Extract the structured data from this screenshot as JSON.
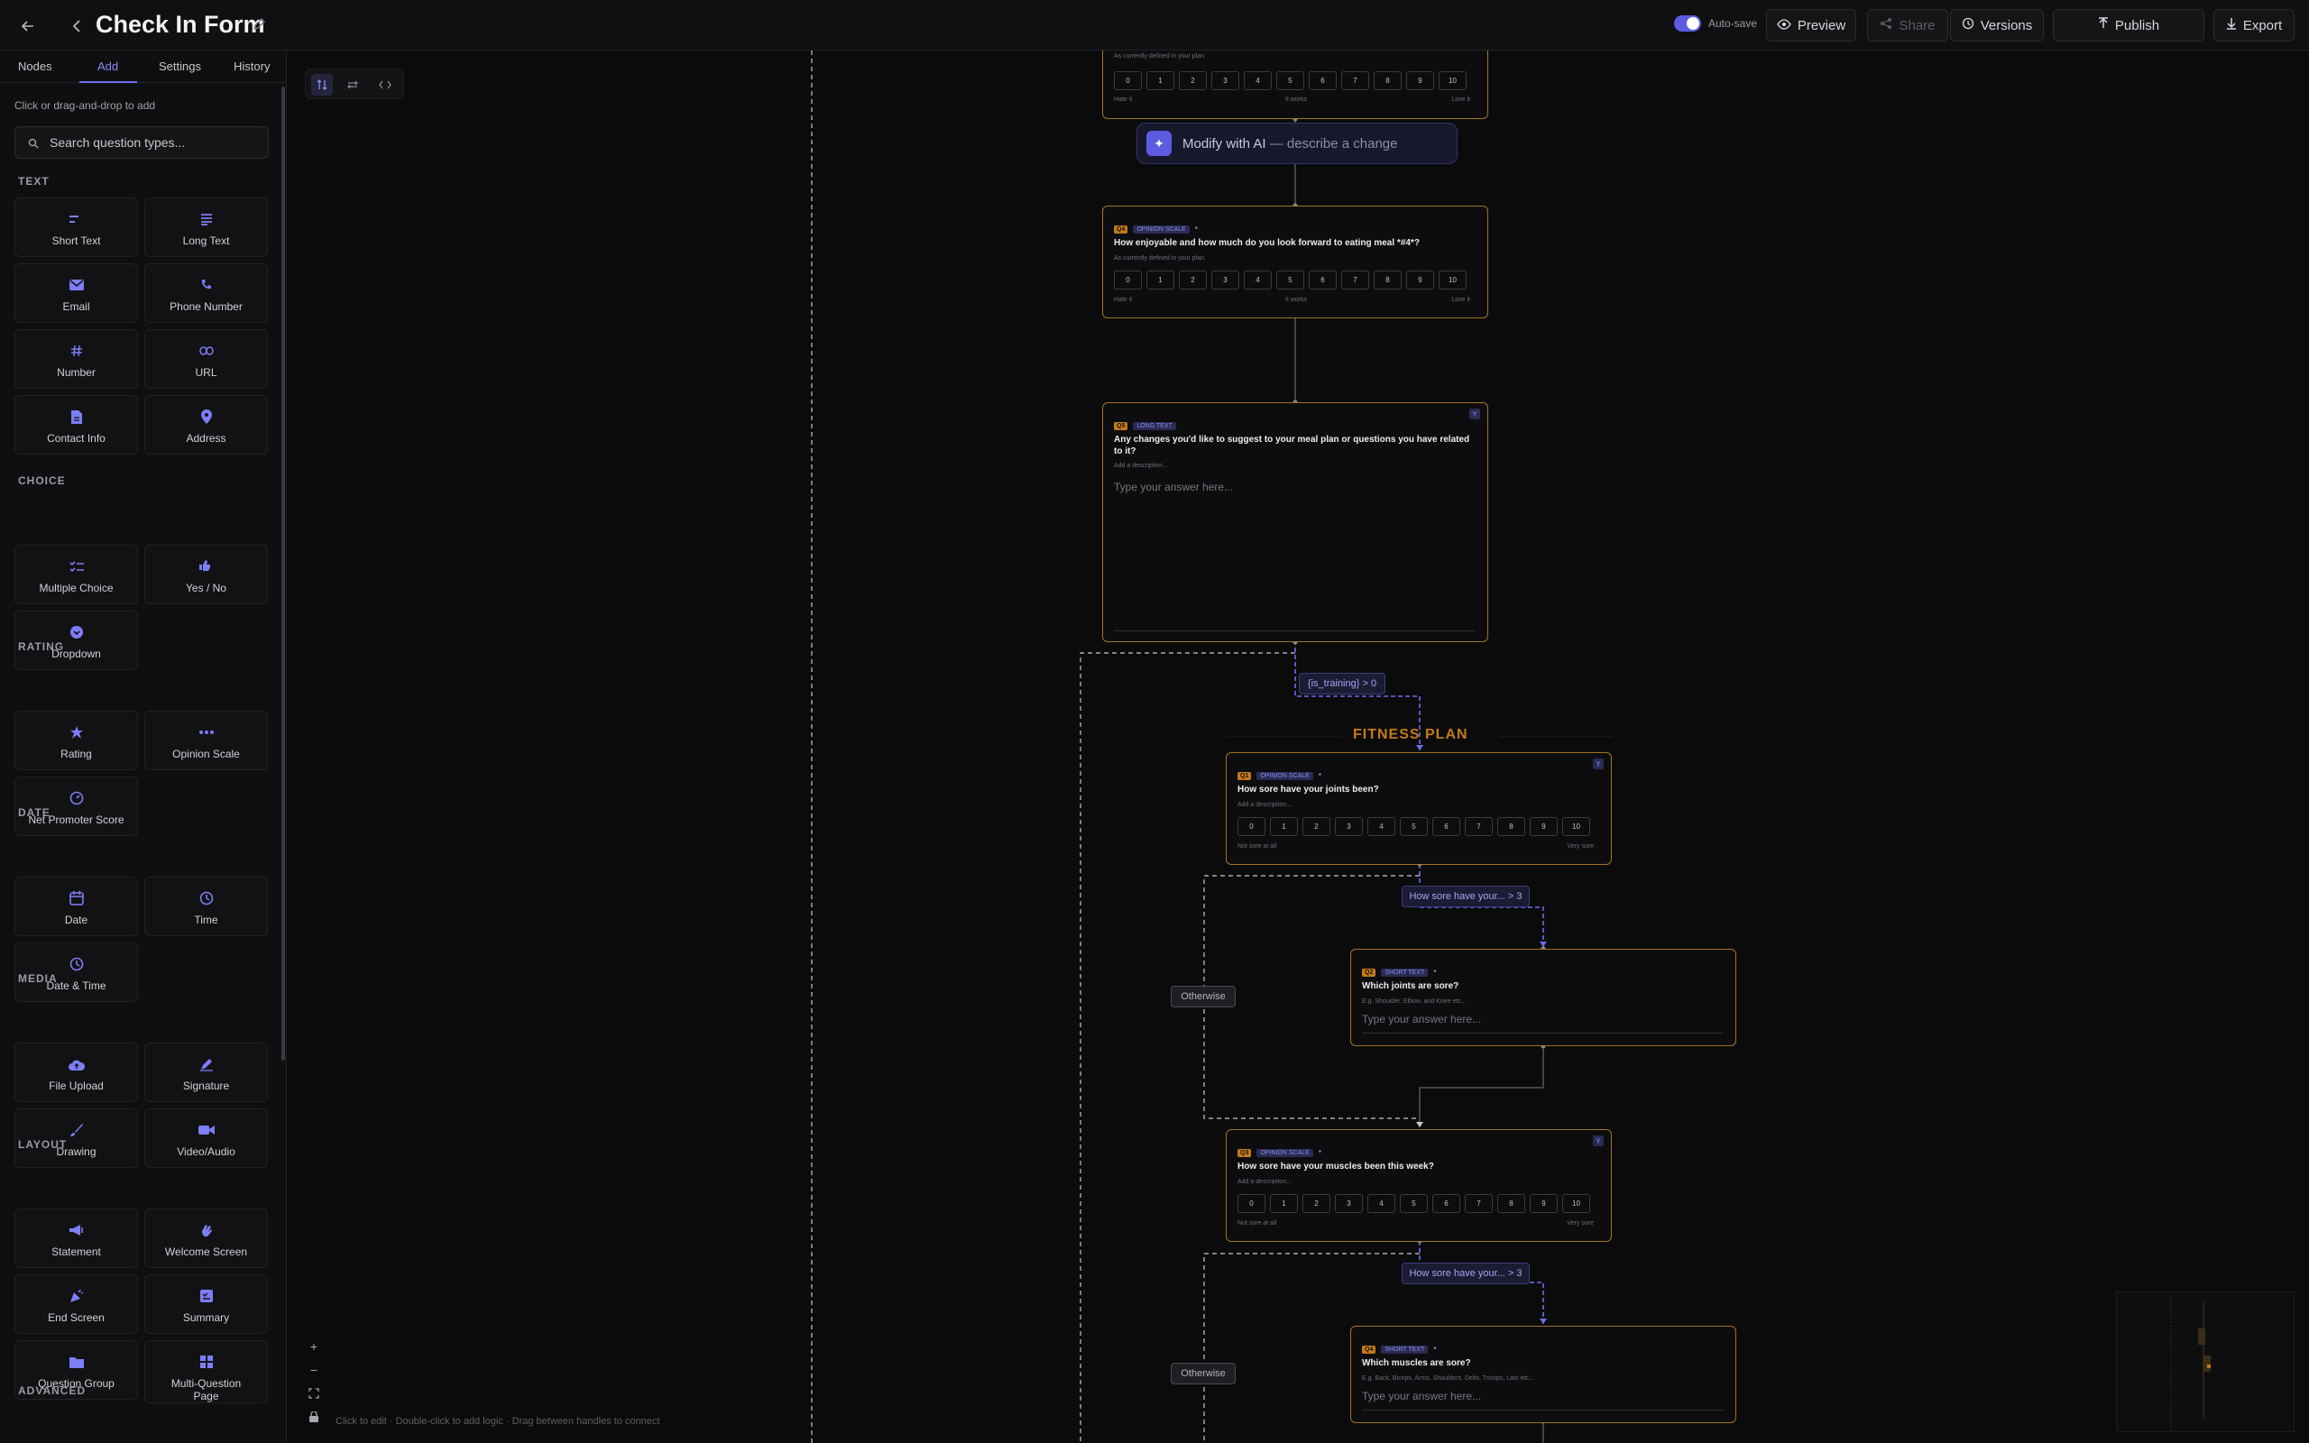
{
  "header": {
    "title": "Check In Form",
    "autosave_label": "Auto-save",
    "preview": "Preview",
    "share": "Share",
    "versions": "Versions",
    "publish": "Publish",
    "export": "Export"
  },
  "sidebar": {
    "tabs": [
      "Nodes",
      "Add",
      "Settings",
      "History"
    ],
    "hint": "Click or drag-and-drop to add",
    "search_placeholder": "Search question types...",
    "sections": {
      "text": "TEXT",
      "choice": "CHOICE",
      "rating": "RATING",
      "date": "DATE",
      "media": "MEDIA",
      "layout": "LAYOUT",
      "advanced": "ADVANCED"
    },
    "items": {
      "short_text": "Short Text",
      "long_text": "Long Text",
      "email": "Email",
      "phone": "Phone Number",
      "number": "Number",
      "url": "URL",
      "contact": "Contact Info",
      "address": "Address",
      "multiple_choice": "Multiple Choice",
      "yes_no": "Yes / No",
      "dropdown": "Dropdown",
      "rating": "Rating",
      "opinion_scale": "Opinion Scale",
      "nps": "Net Promoter Score",
      "date": "Date",
      "time": "Time",
      "datetime": "Date & Time",
      "file_upload": "File Upload",
      "signature": "Signature",
      "drawing": "Drawing",
      "video_audio": "Video/Audio",
      "statement": "Statement",
      "welcome": "Welcome Screen",
      "end": "End Screen",
      "summary": "Summary",
      "question_group": "Question Group",
      "multi_question": "Multi-Question Page"
    }
  },
  "canvas": {
    "help": "Click to edit · Double-click to add logic · Drag between handles to connect",
    "ai_label": "Modify with AI",
    "ai_hint": "— describe a change",
    "group_title": "FITNESS PLAN",
    "otherwise": "Otherwise",
    "scale_values": [
      "0",
      "1",
      "2",
      "3",
      "4",
      "5",
      "6",
      "7",
      "8",
      "9",
      "10"
    ],
    "card0": {
      "desc": "As currently defined in your plan.",
      "left": "Hate it",
      "mid": "It works",
      "right": "Love it"
    },
    "card1": {
      "num": "Q4",
      "type": "OPINION SCALE",
      "req": "*",
      "question": "How enjoyable and how much do you look forward to eating meal *#4*?",
      "desc": "As currently defined in your plan.",
      "left": "Hate it",
      "mid": "It works",
      "right": "Love it"
    },
    "card2": {
      "num": "Q5",
      "type": "LONG TEXT",
      "question": "Any changes you'd like to suggest to your meal plan or questions you have related to it?",
      "desc": "Add a description...",
      "placeholder": "Type your answer here..."
    },
    "cond1": "{is_training} > 0",
    "card3": {
      "num": "Q1",
      "type": "OPINION SCALE",
      "req": "*",
      "question": "How sore have your joints been?",
      "desc": "Add a description...",
      "left": "Not sore at all",
      "right": "Very sore"
    },
    "cond2": "How sore have your... > 3",
    "card4": {
      "num": "Q2",
      "type": "SHORT TEXT",
      "req": "*",
      "question": "Which joints are sore?",
      "desc": "E.g. Shoulder, Elbow, and Knee etc...",
      "placeholder": "Type your answer here..."
    },
    "card5": {
      "num": "Q3",
      "type": "OPINION SCALE",
      "req": "*",
      "question": "How sore have your muscles been this week?",
      "desc": "Add a description...",
      "left": "Not sore at all",
      "right": "Very sore"
    },
    "cond3": "How sore have your... > 3",
    "card6": {
      "num": "Q4",
      "type": "SHORT TEXT",
      "req": "*",
      "question": "Which muscles are sore?",
      "desc": "E.g. Back, Biceps, Arms, Shoulders, Delts, Triceps, Lats etc...",
      "placeholder": "Type your answer here..."
    }
  }
}
